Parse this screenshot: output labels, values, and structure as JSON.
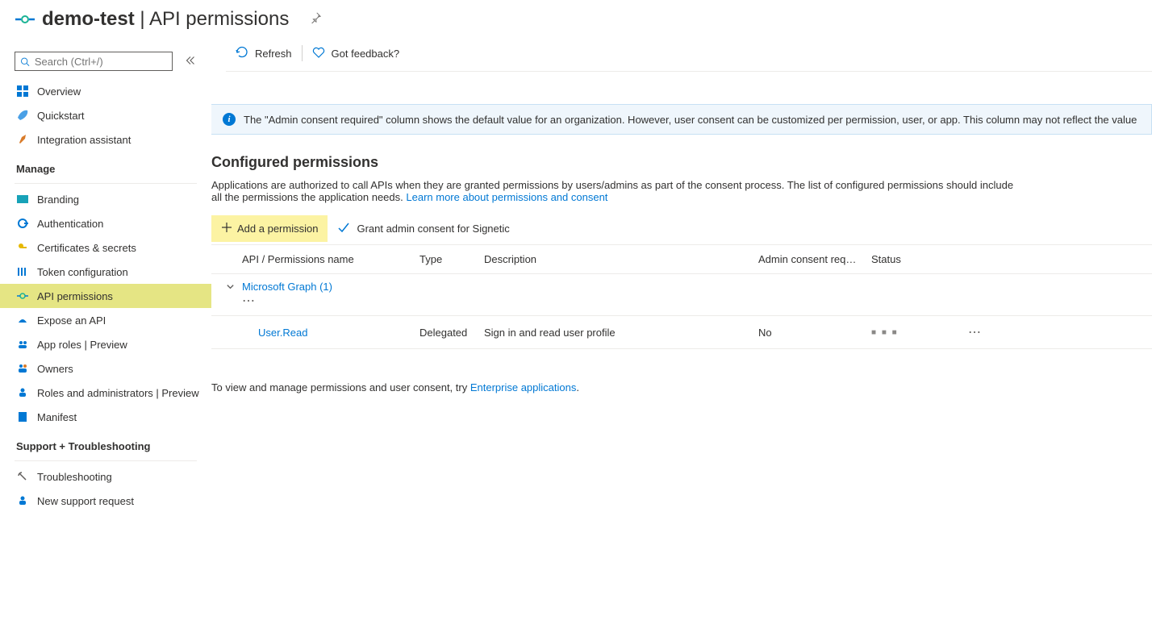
{
  "header": {
    "app_name": "demo-test",
    "separator": " | ",
    "page_title": "API permissions"
  },
  "sidebar": {
    "search_placeholder": "Search (Ctrl+/)",
    "nav_top": [
      {
        "label": "Overview"
      },
      {
        "label": "Quickstart"
      },
      {
        "label": "Integration assistant"
      }
    ],
    "section_manage": "Manage",
    "nav_manage": [
      {
        "label": "Branding"
      },
      {
        "label": "Authentication"
      },
      {
        "label": "Certificates & secrets"
      },
      {
        "label": "Token configuration"
      },
      {
        "label": "API permissions"
      },
      {
        "label": "Expose an API"
      },
      {
        "label": "App roles | Preview"
      },
      {
        "label": "Owners"
      },
      {
        "label": "Roles and administrators | Preview"
      },
      {
        "label": "Manifest"
      }
    ],
    "section_support": "Support + Troubleshooting",
    "nav_support": [
      {
        "label": "Troubleshooting"
      },
      {
        "label": "New support request"
      }
    ]
  },
  "toolbar": {
    "refresh": "Refresh",
    "feedback": "Got feedback?"
  },
  "banner": {
    "text": "The \"Admin consent required\" column shows the default value for an organization. However, user consent can be customized per permission, user, or app. This column may not reflect the value in your organiza"
  },
  "main": {
    "heading": "Configured permissions",
    "body_text": "Applications are authorized to call APIs when they are granted permissions by users/admins as part of the consent process. The list of configured permissions should include all the permissions the application needs. ",
    "learn_link": "Learn more about permissions and consent",
    "add_btn": "Add a permission",
    "grant_btn": "Grant admin consent for Signetic",
    "footer_text_1": "To view and manage permissions and user consent, try ",
    "footer_link": "Enterprise applications",
    "footer_text_2": "."
  },
  "table": {
    "columns": {
      "name": "API / Permissions name",
      "type": "Type",
      "desc": "Description",
      "consent": "Admin consent req…",
      "status": "Status"
    },
    "group": {
      "label": "Microsoft Graph (1)"
    },
    "rows": [
      {
        "name": "User.Read",
        "type": "Delegated",
        "desc": "Sign in and read user profile",
        "consent": "No",
        "status": ""
      }
    ]
  }
}
